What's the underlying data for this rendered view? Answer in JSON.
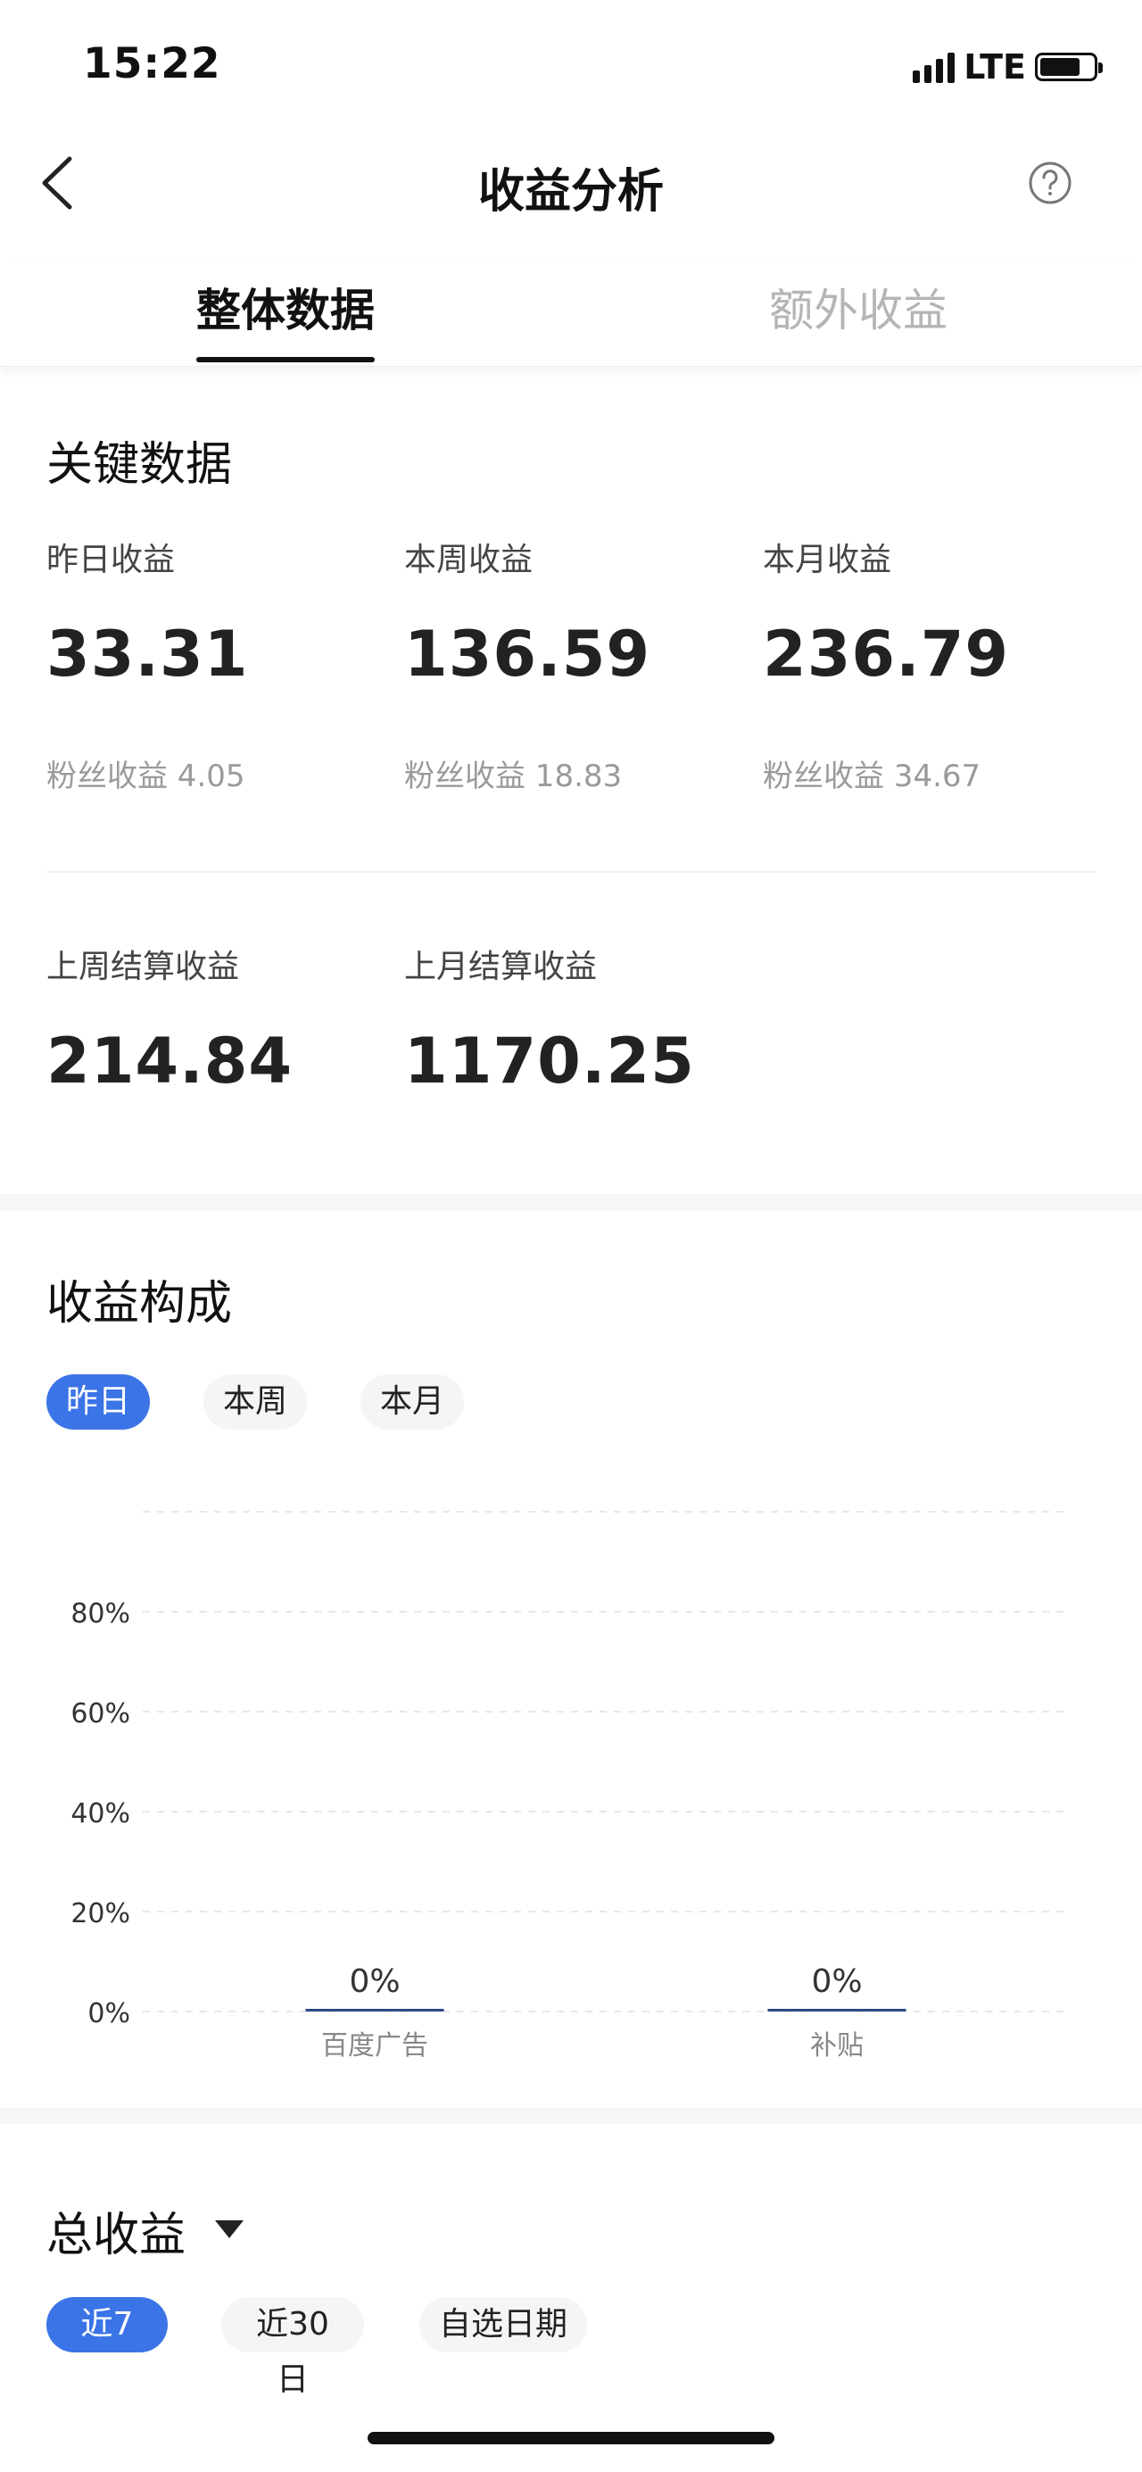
{
  "status_bar": {
    "time": "15:22",
    "network": "LTE"
  },
  "nav": {
    "title": "收益分析"
  },
  "tabs": [
    {
      "label": "整体数据",
      "active": true
    },
    {
      "label": "额外收益",
      "active": false
    }
  ],
  "key_data": {
    "title": "关键数据",
    "metrics": [
      {
        "label": "昨日收益",
        "value": "33.31",
        "fan": "粉丝收益 4.05"
      },
      {
        "label": "本周收益",
        "value": "136.59",
        "fan": "粉丝收益 18.83"
      },
      {
        "label": "本月收益",
        "value": "236.79",
        "fan": "粉丝收益 34.67"
      }
    ],
    "settled": [
      {
        "label": "上周结算收益",
        "value": "214.84"
      },
      {
        "label": "上月结算收益",
        "value": "1170.25"
      }
    ]
  },
  "composition": {
    "title": "收益构成",
    "chips": [
      {
        "label": "昨日",
        "active": true
      },
      {
        "label": "本周",
        "active": false
      },
      {
        "label": "本月",
        "active": false
      }
    ]
  },
  "chart_data": {
    "type": "bar",
    "categories": [
      "百度广告",
      "补贴"
    ],
    "values": [
      0,
      0
    ],
    "data_labels": [
      "0%",
      "0%"
    ],
    "y_ticks": [
      "0%",
      "20%",
      "40%",
      "60%",
      "80%"
    ],
    "ylim": [
      0,
      100
    ],
    "grid": true,
    "colors": {
      "bar": "#2b4a8a",
      "grid": "#e8e8e8"
    }
  },
  "total": {
    "title": "总收益",
    "chips": [
      {
        "label": "近7日",
        "active": true
      },
      {
        "label": "近30日",
        "active": false
      },
      {
        "label": "自选日期",
        "active": false
      }
    ]
  },
  "colors": {
    "accent": "#3b74e6",
    "text": "#222222",
    "muted": "#9a9a9a"
  }
}
